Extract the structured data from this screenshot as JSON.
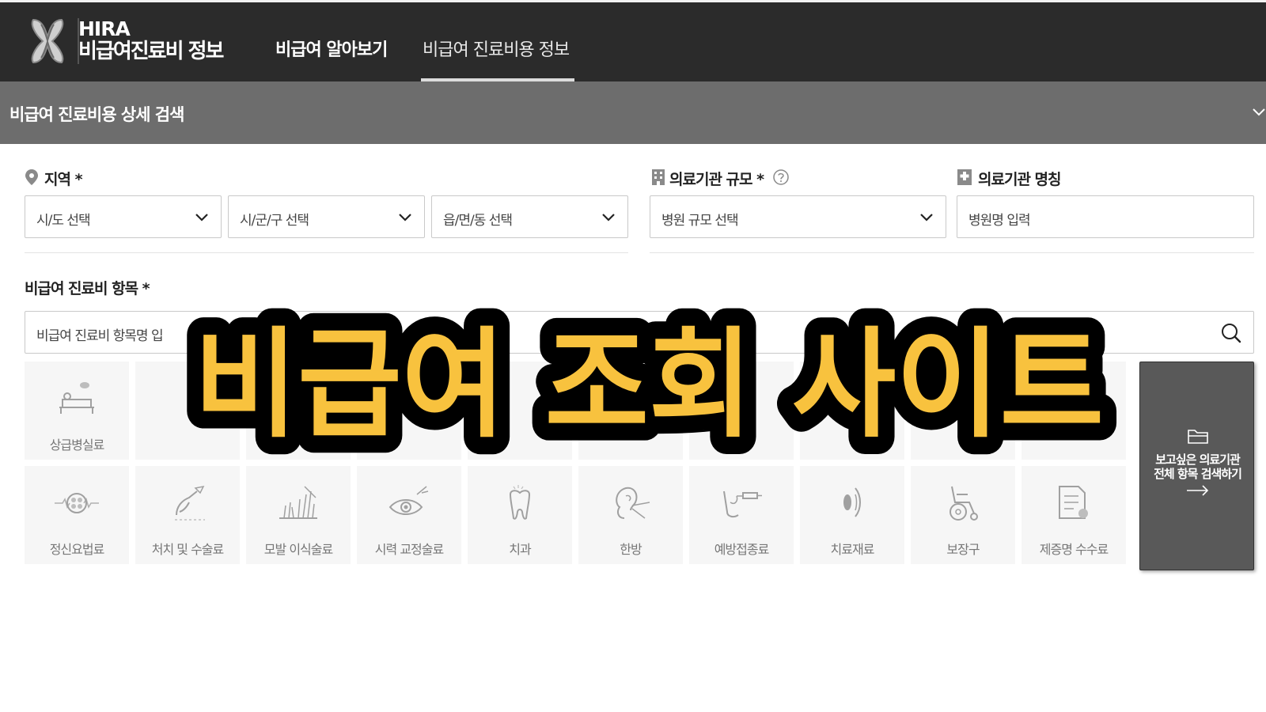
{
  "header": {
    "brand_top": "HIRA",
    "brand_bottom": "비급여진료비 정보",
    "nav": [
      {
        "label": "비급여 알아보기",
        "active": false
      },
      {
        "label": "비급여 진료비용 정보",
        "active": true
      }
    ]
  },
  "panel": {
    "title": "비급여 진료비용 상세 검색"
  },
  "filters": {
    "region_label": "지역 *",
    "sido_placeholder": "시/도 선택",
    "sigungu_placeholder": "시/군/구 선택",
    "dong_placeholder": "읍/면/동 선택",
    "scale_label": "의료기관 규모 *",
    "scale_placeholder": "병원 규모 선택",
    "name_label": "의료기관 명칭",
    "name_placeholder": "병원명 입력"
  },
  "items": {
    "label": "비급여 진료비 항목 *",
    "search_placeholder": "비급여 진료비 항목명 입",
    "row1": [
      {
        "label": "상급병실료",
        "icon": "bed-icon"
      },
      {
        "label": "",
        "icon": "blank-icon"
      },
      {
        "label": "",
        "icon": "blank-icon"
      },
      {
        "label": "",
        "icon": "blank-icon"
      },
      {
        "label": "",
        "icon": "blank-icon"
      },
      {
        "label": "",
        "icon": "blank-icon"
      },
      {
        "label": "",
        "icon": "blank-icon"
      },
      {
        "label": "",
        "icon": "blank-icon"
      },
      {
        "label": "",
        "icon": "blank-icon"
      },
      {
        "label": "",
        "icon": "blank-icon"
      }
    ],
    "row2": [
      {
        "label": "정신요법료",
        "icon": "brain-icon"
      },
      {
        "label": "처치 및 수술료",
        "icon": "scalpel-hand-icon"
      },
      {
        "label": "모발 이식술료",
        "icon": "hair-icon"
      },
      {
        "label": "시력 교정술료",
        "icon": "eye-icon"
      },
      {
        "label": "치과",
        "icon": "tooth-icon"
      },
      {
        "label": "한방",
        "icon": "ear-needle-icon"
      },
      {
        "label": "예방접종료",
        "icon": "syringe-arm-icon"
      },
      {
        "label": "치료재료",
        "icon": "lens-icon"
      },
      {
        "label": "보장구",
        "icon": "wheelchair-icon"
      },
      {
        "label": "제증명 수수료",
        "icon": "certificate-icon"
      }
    ],
    "all_button_line1": "보고싶은 의료기관",
    "all_button_line2": "전체 항목 검색하기"
  },
  "overlay": {
    "text": "비급여 조회 사이트",
    "fill_color": "#f8c23e",
    "stroke_color": "#000000"
  }
}
